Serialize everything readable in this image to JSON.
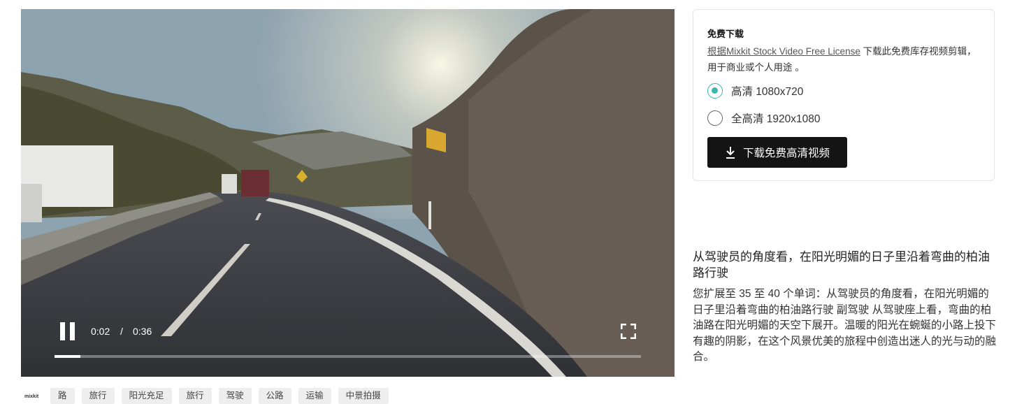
{
  "player": {
    "time_current": "0:02",
    "time_separator": "/",
    "time_duration": "0:36",
    "progress": 0.044,
    "state": "playing",
    "icons": {
      "pause": "pause-icon",
      "fullscreen": "fullscreen-icon"
    }
  },
  "download": {
    "title": "免费下载",
    "license_link": "根据Mixkit Stock Video Free License",
    "license_text": " 下载此免费库存视频剪辑，用于商业或个人用途 。",
    "options": [
      {
        "label": "高清 1080x720",
        "selected": true
      },
      {
        "label": "全高清 1920x1080",
        "selected": false
      }
    ],
    "button_label": "下载免费高清视频",
    "button_icon": "download-icon",
    "accent_color": "#3fb3b0"
  },
  "description": {
    "title": "从驾驶员的角度看，在阳光明媚的日子里沿着弯曲的柏油路行驶",
    "body": "您扩展至 35 至 40 个单词：从驾驶员的角度看，在阳光明媚的日子里沿着弯曲的柏油路行驶 副驾驶 从驾驶座上看，弯曲的柏油路在阳光明媚的天空下展开。温暖的阳光在蜿蜒的小路上投下有趣的阴影，在这个风景优美的旅程中创造出迷人的光与动的融合。"
  },
  "brand": "mixkit",
  "tags": [
    "路",
    "旅行",
    "阳光充足",
    "旅行",
    "驾驶",
    "公路",
    "运输",
    "中景拍摄"
  ]
}
